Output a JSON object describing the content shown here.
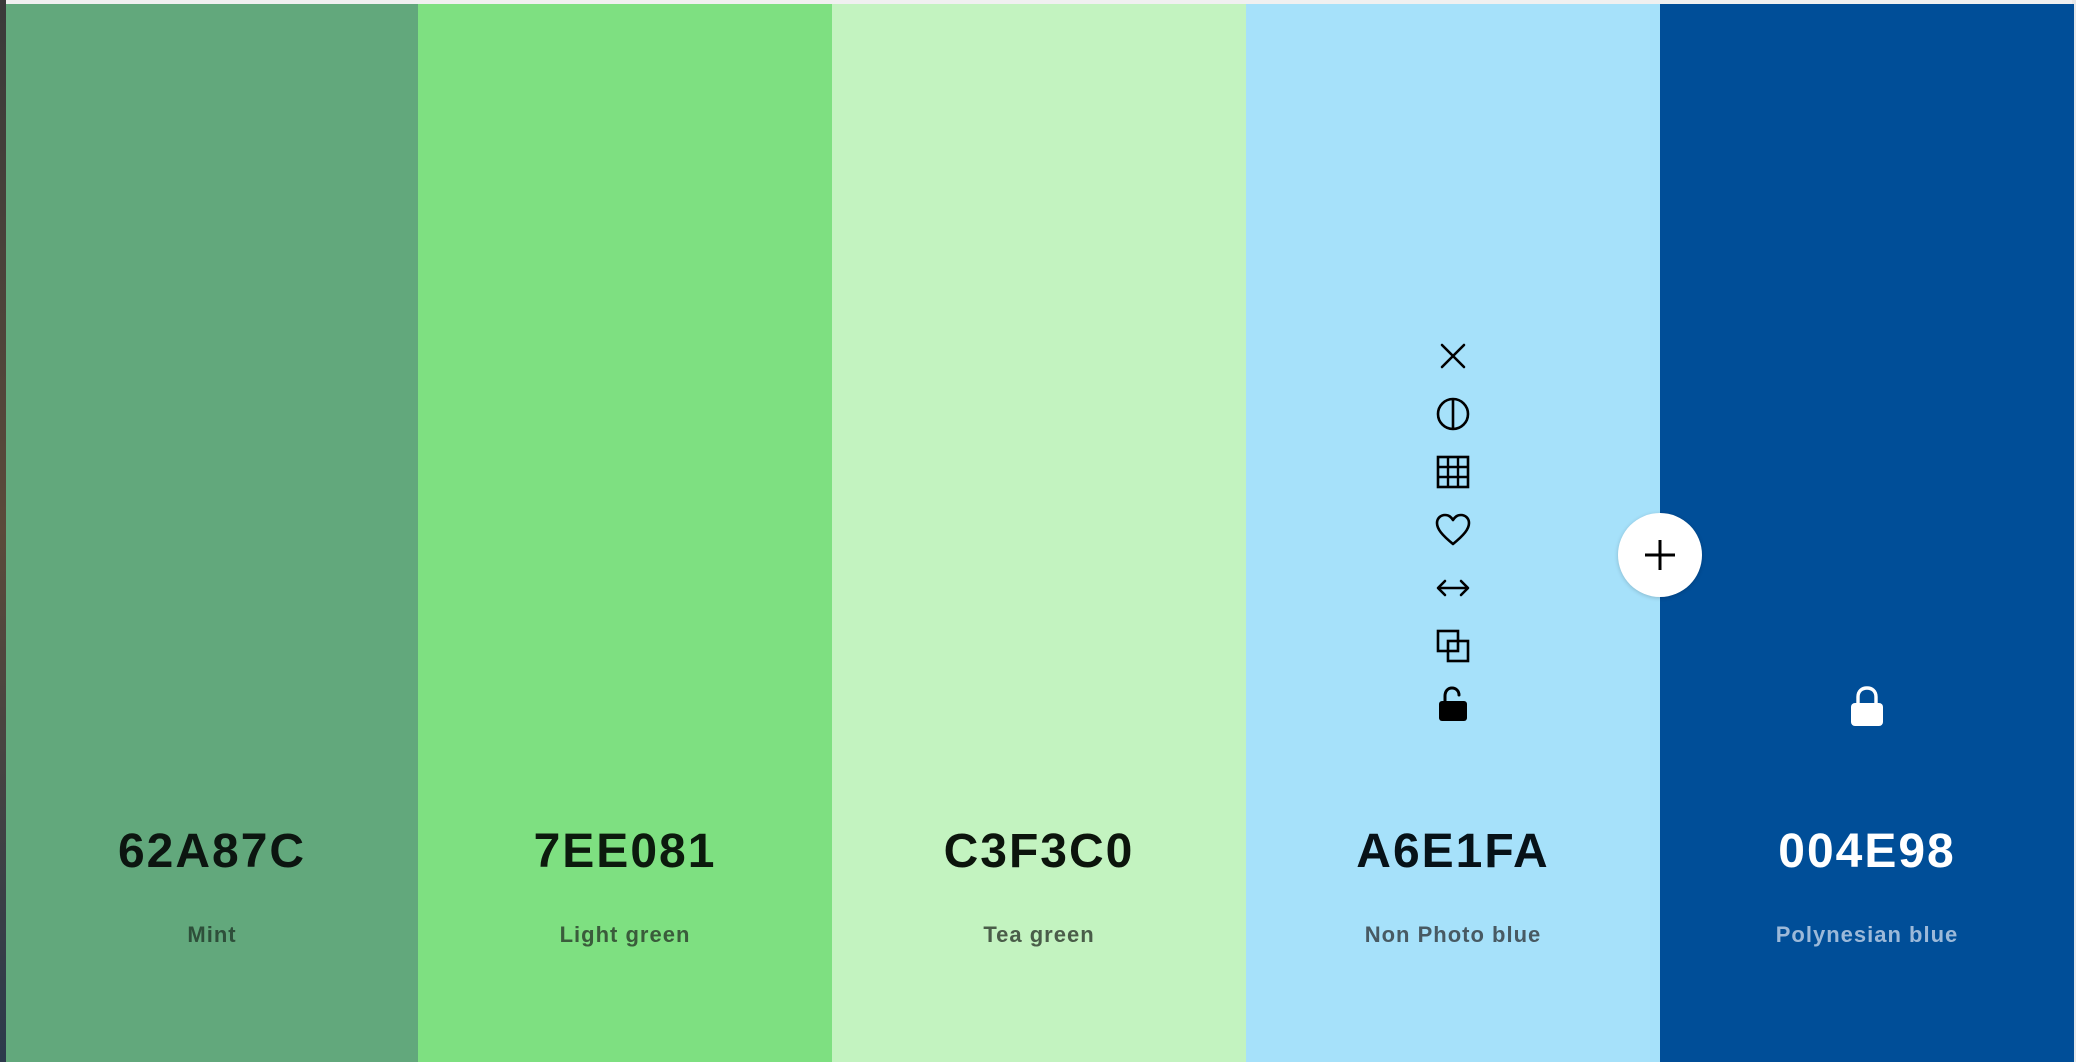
{
  "palette": {
    "swatches": [
      {
        "hex": "62A87C",
        "name": "Mint",
        "bg": "#62A87C",
        "hex_color": "#0c1510",
        "name_color": "#2e4f3a"
      },
      {
        "hex": "7EE081",
        "name": "Light green",
        "bg": "#7EE081",
        "hex_color": "#0c1a0d",
        "name_color": "#3a5c3b"
      },
      {
        "hex": "C3F3C0",
        "name": "Tea green",
        "bg": "#C3F3C0",
        "hex_color": "#0c140c",
        "name_color": "#4a5d49"
      },
      {
        "hex": "A6E1FA",
        "name": "Non Photo blue",
        "bg": "#A6E1FA",
        "hex_color": "#071218",
        "name_color": "#485a63"
      },
      {
        "hex": "004E98",
        "name": "Polynesian blue",
        "bg": "#004E98",
        "hex_color": "#ffffff",
        "name_color": "#9cb9d9"
      }
    ],
    "hover_tools_icons": [
      "close-icon",
      "contrast-icon",
      "shades-grid-icon",
      "heart-icon",
      "drag-arrows-icon",
      "copy-icon",
      "unlock-icon"
    ],
    "locked_swatch_icon": "lock-icon",
    "add_button_icon": "plus-icon"
  }
}
